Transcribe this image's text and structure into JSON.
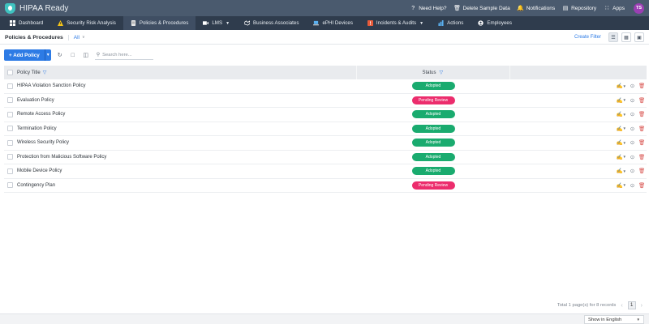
{
  "app": {
    "title": "HIPAA Ready"
  },
  "topbar": {
    "items": [
      {
        "label": "Need Help?",
        "icon": "question-icon"
      },
      {
        "label": "Delete Sample Data",
        "icon": "trash-icon"
      },
      {
        "label": "Notifications",
        "icon": "bell-icon"
      },
      {
        "label": "Repository",
        "icon": "book-icon"
      },
      {
        "label": "Apps",
        "icon": "grid-icon"
      }
    ],
    "avatar_initials": "TS"
  },
  "nav": {
    "items": [
      {
        "label": "Dashboard",
        "icon": "dashboard-icon",
        "active": false,
        "dropdown": false
      },
      {
        "label": "Security Risk Analysis",
        "icon": "warning-icon",
        "active": false,
        "dropdown": false
      },
      {
        "label": "Policies & Procedures",
        "icon": "document-icon",
        "active": true,
        "dropdown": false
      },
      {
        "label": "LMS",
        "icon": "video-icon",
        "active": false,
        "dropdown": true
      },
      {
        "label": "Business Associates",
        "icon": "handshake-icon",
        "active": false,
        "dropdown": false
      },
      {
        "label": "ePHI Devices",
        "icon": "laptop-icon",
        "active": false,
        "dropdown": false
      },
      {
        "label": "Incidents & Audits",
        "icon": "alert-icon",
        "active": false,
        "dropdown": true
      },
      {
        "label": "Actions",
        "icon": "chart-icon",
        "active": false,
        "dropdown": false
      },
      {
        "label": "Employees",
        "icon": "people-icon",
        "active": false,
        "dropdown": false
      }
    ]
  },
  "header": {
    "title": "Policies & Procedures",
    "filter_value": "All",
    "create_filter_label": "Create Filter"
  },
  "toolbar": {
    "add_label": "+ Add Policy",
    "search_placeholder": "Search here..."
  },
  "table": {
    "columns": {
      "title": "Policy Title",
      "status": "Status"
    },
    "rows": [
      {
        "title": "HIPAA Violation Sanction Policy",
        "status": "Adopted",
        "status_color": "#1aab6f"
      },
      {
        "title": "Evaluation Policy",
        "status": "Pending Review",
        "status_color": "#ec2d6d"
      },
      {
        "title": "Remote Access Policy",
        "status": "Adopted",
        "status_color": "#1aab6f"
      },
      {
        "title": "Termination Policy",
        "status": "Adopted",
        "status_color": "#1aab6f"
      },
      {
        "title": "Wireless Security Policy",
        "status": "Adopted",
        "status_color": "#1aab6f"
      },
      {
        "title": "Protection from Malicious Software Policy",
        "status": "Adopted",
        "status_color": "#1aab6f"
      },
      {
        "title": "Mobile Device Policy",
        "status": "Adopted",
        "status_color": "#1aab6f"
      },
      {
        "title": "Contingency Plan",
        "status": "Pending Review",
        "status_color": "#ec2d6d"
      }
    ]
  },
  "pagination": {
    "summary": "Total 1 page(s) for 8 records",
    "current_page": "1"
  },
  "footer": {
    "language": "Show in English"
  },
  "colors": {
    "topbar": "#4a5a6e",
    "navbar": "#2f3c4d",
    "accent": "#2d7be5",
    "adopted": "#1aab6f",
    "pending": "#ec2d6d"
  }
}
